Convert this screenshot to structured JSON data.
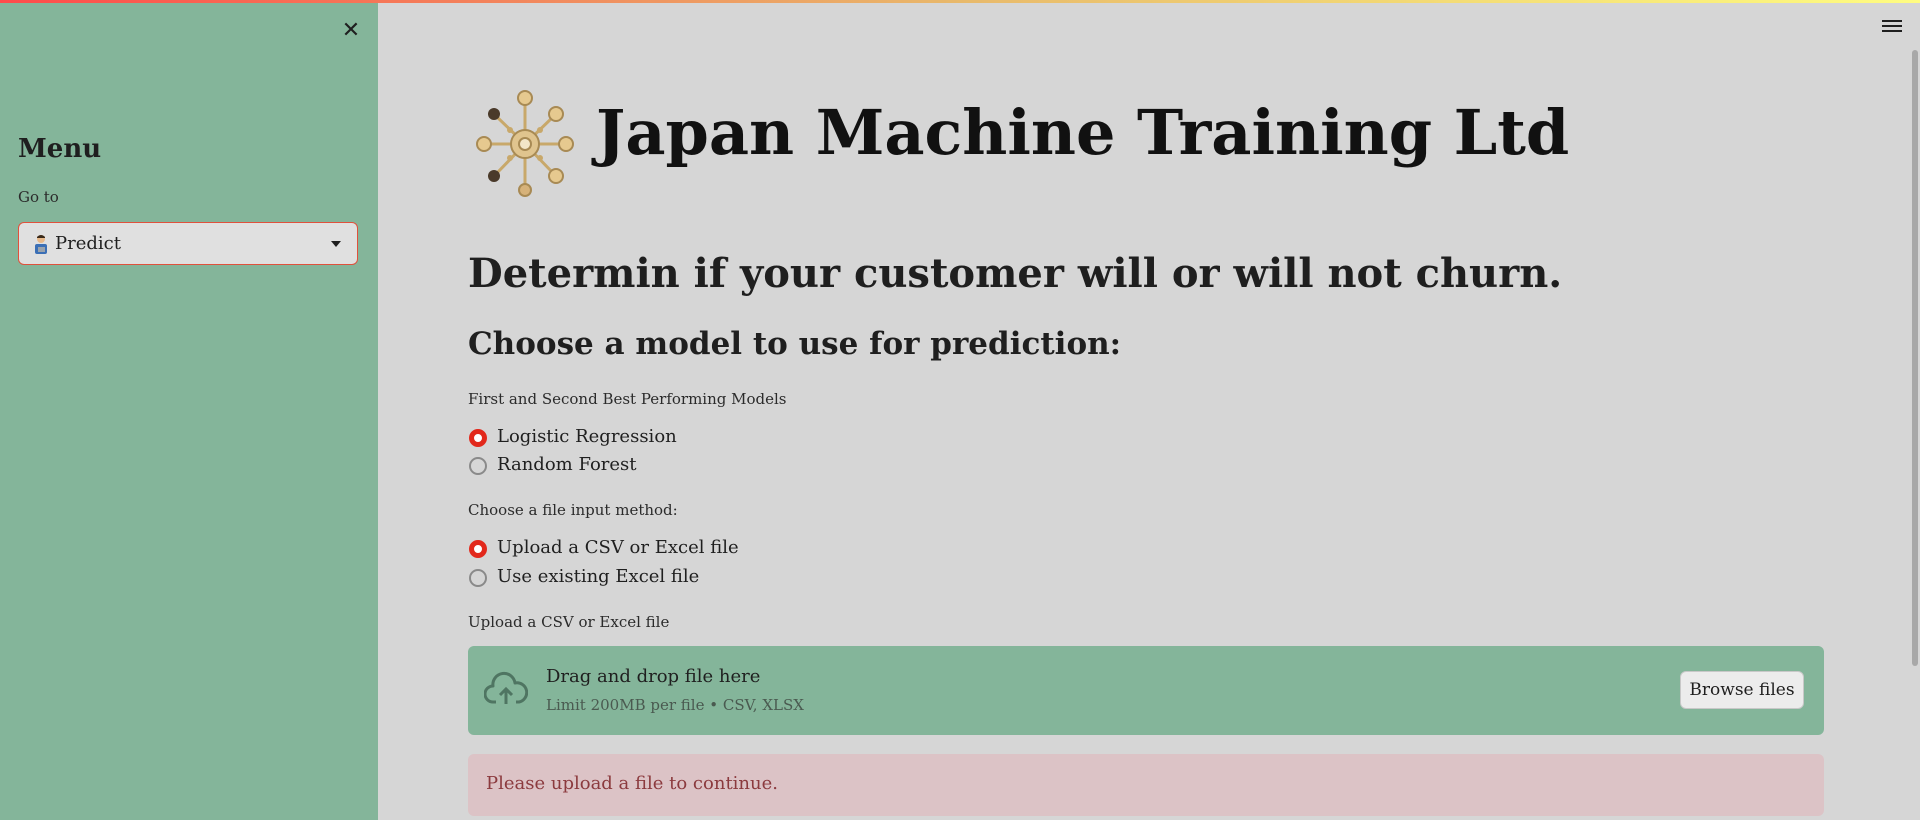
{
  "sidebar": {
    "menu_title": "Menu",
    "goto_label": "Go to",
    "selected_page": "Predict",
    "selected_icon": "person-technologist-icon"
  },
  "main": {
    "app_title": "Japan Machine Training Ltd",
    "heading": "Determin if your customer will or will not churn.",
    "subheading": "Choose a model to use for prediction:",
    "model_group": {
      "label": "First and Second Best Performing Models",
      "options": [
        "Logistic Regression",
        "Random Forest"
      ],
      "selected": "Logistic Regression"
    },
    "input_method_group": {
      "label": "Choose a file input method:",
      "options": [
        "Upload a CSV or Excel file",
        "Use existing Excel file"
      ],
      "selected": "Upload a CSV or Excel file"
    },
    "uploader": {
      "label": "Upload a CSV or Excel file",
      "drop_title": "Drag and drop file here",
      "limit_text": "Limit 200MB per file • CSV, XLSX",
      "browse_label": "Browse files"
    },
    "alert_text": "Please upload a file to continue."
  },
  "colors": {
    "sidebar_bg": "#84b59a",
    "main_bg": "#d6d6d6",
    "accent": "#e2281b",
    "alert_bg": "#dcc3c6",
    "alert_text": "#8b3a3e"
  }
}
